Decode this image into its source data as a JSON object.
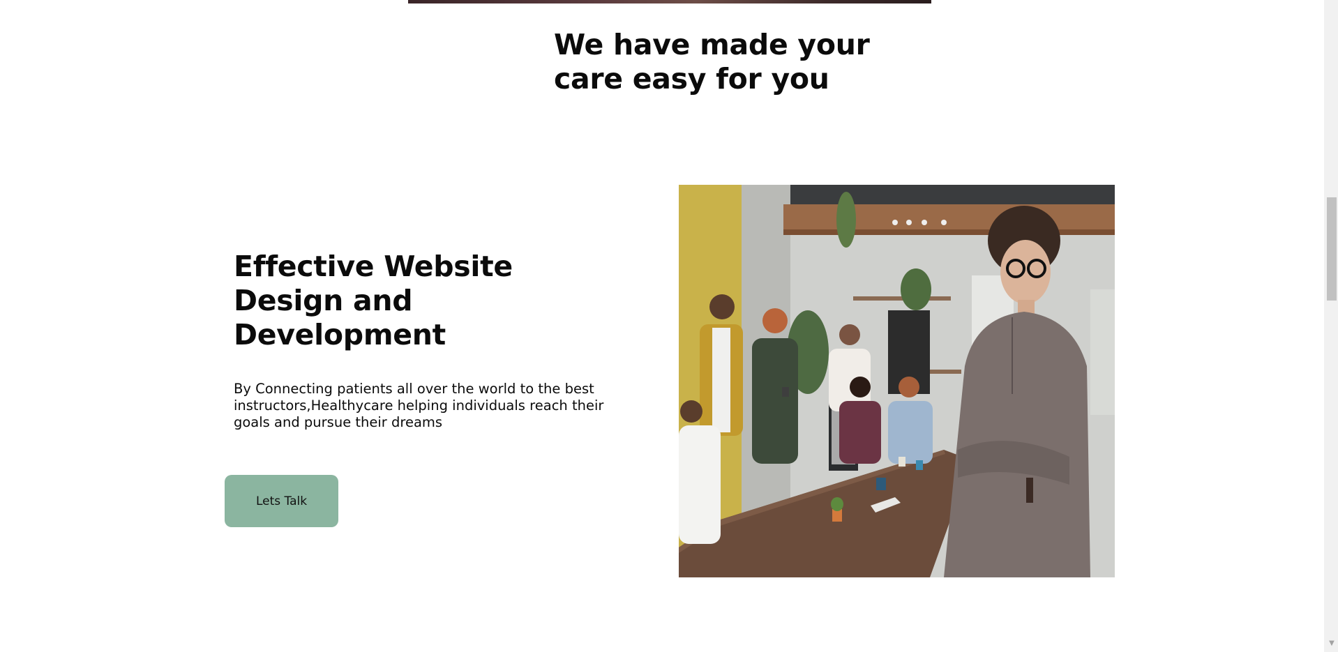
{
  "section": {
    "heading": "We have made your care easy for you"
  },
  "feature": {
    "title": "Effective Website Design and Development",
    "description": "By Connecting patients all over the world to the best instructors,Healthycare helping individuals reach their goals and pursue their dreams",
    "cta_label": "Lets Talk"
  },
  "colors": {
    "button_bg": "#8bb5a0",
    "text": "#0b0b0b",
    "background": "#ffffff"
  },
  "icons": {
    "scroll_down": "chevron-down-icon"
  }
}
